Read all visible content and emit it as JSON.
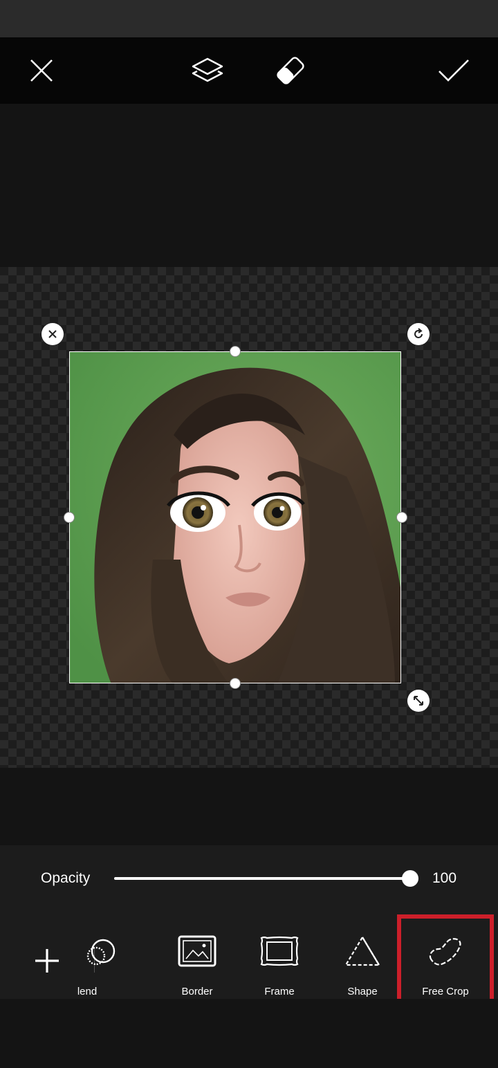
{
  "topbar": {
    "close_icon": "close-icon",
    "layers_icon": "layers-icon",
    "eraser_icon": "eraser-icon",
    "apply_icon": "checkmark-icon"
  },
  "editor": {
    "delete_icon": "close-icon",
    "rotate_icon": "rotate-icon",
    "scale_icon": "resize-arrows-icon",
    "photo_description": "cartoon portrait on green background"
  },
  "opacity": {
    "label": "Opacity",
    "value": "100",
    "level": 1.0
  },
  "toolbar": {
    "add_icon": "plus-icon",
    "tools": [
      {
        "label": "Blend",
        "icon": "blend-icon",
        "visible_text": "Blend"
      },
      {
        "label": "Border",
        "icon": "border-image-icon"
      },
      {
        "label": "Frame",
        "icon": "frame-icon"
      },
      {
        "label": "Shape",
        "icon": "dashed-triangle-icon"
      },
      {
        "label": "Free Crop",
        "icon": "free-crop-icon"
      }
    ],
    "highlight_color": "#cc1f2a"
  }
}
